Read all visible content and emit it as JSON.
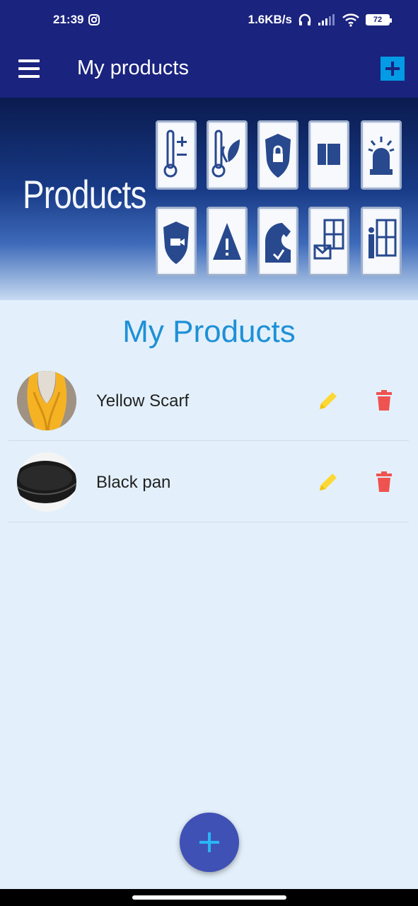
{
  "status_bar": {
    "time": "21:39",
    "net_speed": "1.6KB/s",
    "battery": "72",
    "icons": [
      "instagram-icon",
      "headset-icon",
      "signal-icon",
      "wifi-icon",
      "battery-icon"
    ]
  },
  "app_bar": {
    "title": "My products",
    "menu_icon": "menu-icon",
    "add_icon": "plus-icon"
  },
  "banner": {
    "text": "Products",
    "icons": [
      "thermometer-plus-minus-icon",
      "thermometer-leaf-icon",
      "shield-lock-icon",
      "door-sensor-icon",
      "siren-icon",
      "shield-camera-icon",
      "warning-triangle-icon",
      "pet-icon",
      "window-mail-icon",
      "person-window-icon"
    ]
  },
  "section_title": "My Products",
  "products": [
    {
      "name": "Yellow Scarf",
      "image": "yellow-scarf-photo"
    },
    {
      "name": "Black pan",
      "image": "black-pan-photo"
    }
  ],
  "colors": {
    "app_bar": "#1a237e",
    "background": "#e3f0fb",
    "title_blue": "#1e90d6",
    "edit_yellow": "#fdd835",
    "delete_red": "#ef5350",
    "fab": "#3f51b5",
    "fab_plus": "#29b6f6",
    "add_button": "#039be5"
  }
}
